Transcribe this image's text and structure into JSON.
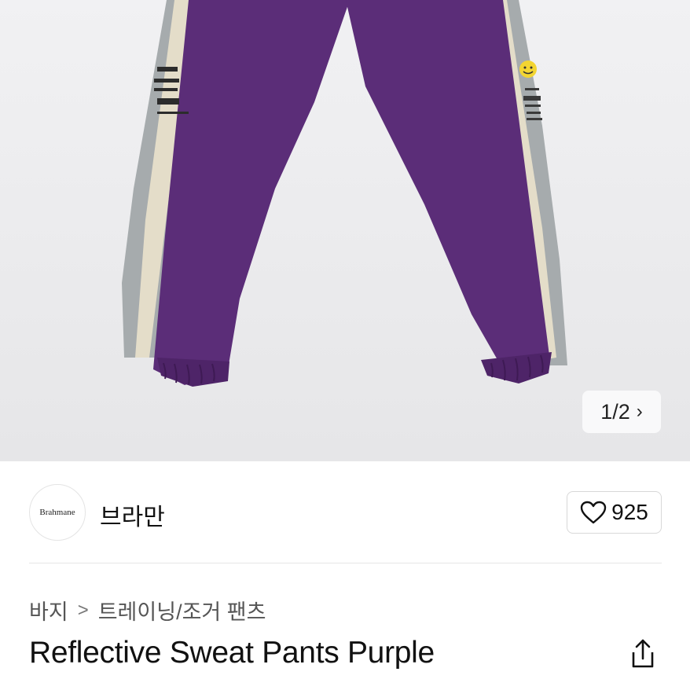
{
  "gallery": {
    "counter_text": "1/2",
    "chevron": "›",
    "image_alt": "purple reflective sweat pants product photo"
  },
  "brand": {
    "logo_text": "Brahmane",
    "name": "브라만"
  },
  "like": {
    "icon": "heart-icon",
    "count": "925"
  },
  "breadcrumb": {
    "level1": "바지",
    "separator": ">",
    "level2": "트레이닝/조거 팬츠"
  },
  "product": {
    "title": "Reflective Sweat Pants Purple"
  },
  "actions": {
    "share_icon": "share-icon"
  },
  "colors": {
    "pants_purple": "#5b2d78",
    "reflective_gray": "#a4aaac",
    "cream_stripe": "#e8e0cc",
    "background": "#ececee"
  }
}
